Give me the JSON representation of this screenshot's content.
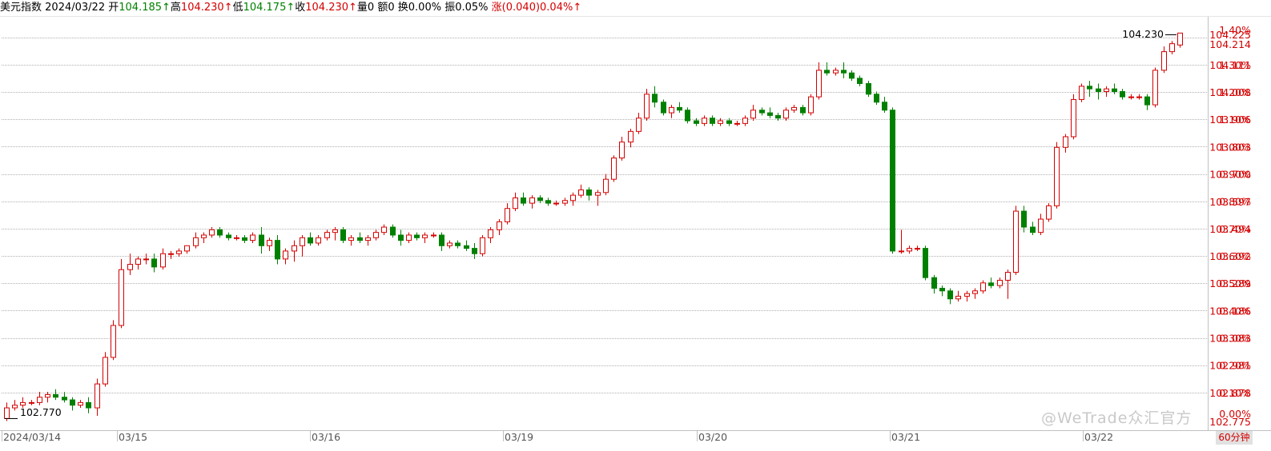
{
  "header": {
    "name": "美元指数",
    "date": "2024/03/22",
    "open_label": "开",
    "open_value": "104.185↑",
    "high_label": "高",
    "high_value": "104.230↑",
    "low_label": "低",
    "low_value": "104.175↑",
    "close_label": "收",
    "close_value": "104.230↑",
    "volume": "量0",
    "amount": "额0",
    "turnover": "换0.00%",
    "amplitude": "振0.05%",
    "change": "涨(0.040)0.04%↑"
  },
  "period_label": "60分钟",
  "watermark": "@WeTrade众汇官方",
  "colors": {
    "up": "#d40000",
    "down": "#008000",
    "grid": "#b0b0b0",
    "axis": "#c0c0c0"
  },
  "chart_data": {
    "type": "candlestick",
    "x_dates": [
      "2024/03/14",
      "03/15",
      "03/16",
      "03/19",
      "03/20",
      "03/21",
      "03/22"
    ],
    "ylim": [
      102.775,
      104.225
    ],
    "yaxis_price_ticks": [
      "104.225",
      "104.214",
      "104.111",
      "104.008",
      "103.906",
      "103.803",
      "103.700",
      "103.597",
      "103.494",
      "103.392",
      "103.289",
      "103.186",
      "103.083",
      "102.981",
      "102.878",
      "102.775"
    ],
    "yaxis_pct_ticks": [
      "1.40%",
      "1.30%",
      "1.20%",
      "1.10%",
      "1.00%",
      "0.90%",
      "0.80%",
      "0.70%",
      "0.60%",
      "0.50%",
      "0.40%",
      "0.30%",
      "0.20%",
      "0.10%",
      "0.00%"
    ],
    "high_marker": "104.230",
    "low_marker": "102.770",
    "candles": [
      [
        102.78,
        102.84,
        102.77,
        102.82
      ],
      [
        102.82,
        102.85,
        102.81,
        102.83
      ],
      [
        102.83,
        102.86,
        102.82,
        102.84
      ],
      [
        102.84,
        102.85,
        102.83,
        102.84
      ],
      [
        102.84,
        102.88,
        102.83,
        102.86
      ],
      [
        102.86,
        102.88,
        102.84,
        102.87
      ],
      [
        102.87,
        102.89,
        102.85,
        102.86
      ],
      [
        102.86,
        102.88,
        102.84,
        102.85
      ],
      [
        102.85,
        102.86,
        102.81,
        102.83
      ],
      [
        102.83,
        102.85,
        102.82,
        102.84
      ],
      [
        102.84,
        102.86,
        102.8,
        102.82
      ],
      [
        102.82,
        102.93,
        102.79,
        102.91
      ],
      [
        102.91,
        103.03,
        102.9,
        103.01
      ],
      [
        103.01,
        103.15,
        103.0,
        103.13
      ],
      [
        103.13,
        103.38,
        103.12,
        103.34
      ],
      [
        103.34,
        103.4,
        103.32,
        103.36
      ],
      [
        103.36,
        103.39,
        103.34,
        103.38
      ],
      [
        103.38,
        103.4,
        103.36,
        103.38
      ],
      [
        103.38,
        103.4,
        103.33,
        103.35
      ],
      [
        103.35,
        103.42,
        103.34,
        103.4
      ],
      [
        103.4,
        103.41,
        103.38,
        103.4
      ],
      [
        103.4,
        103.42,
        103.39,
        103.41
      ],
      [
        103.41,
        103.43,
        103.4,
        103.43
      ],
      [
        103.43,
        103.48,
        103.42,
        103.46
      ],
      [
        103.46,
        103.48,
        103.44,
        103.47
      ],
      [
        103.47,
        103.5,
        103.46,
        103.49
      ],
      [
        103.49,
        103.5,
        103.46,
        103.47
      ],
      [
        103.47,
        103.48,
        103.45,
        103.46
      ],
      [
        103.46,
        103.47,
        103.45,
        103.46
      ],
      [
        103.46,
        103.47,
        103.44,
        103.45
      ],
      [
        103.45,
        103.48,
        103.44,
        103.47
      ],
      [
        103.47,
        103.5,
        103.4,
        103.43
      ],
      [
        103.43,
        103.46,
        103.41,
        103.45
      ],
      [
        103.45,
        103.47,
        103.36,
        103.38
      ],
      [
        103.38,
        103.42,
        103.36,
        103.41
      ],
      [
        103.41,
        103.45,
        103.37,
        103.43
      ],
      [
        103.43,
        103.47,
        103.39,
        103.46
      ],
      [
        103.46,
        103.48,
        103.43,
        103.44
      ],
      [
        103.44,
        103.47,
        103.43,
        103.46
      ],
      [
        103.46,
        103.49,
        103.45,
        103.48
      ],
      [
        103.48,
        103.5,
        103.45,
        103.49
      ],
      [
        103.49,
        103.5,
        103.44,
        103.45
      ],
      [
        103.45,
        103.47,
        103.43,
        103.46
      ],
      [
        103.46,
        103.48,
        103.44,
        103.45
      ],
      [
        103.45,
        103.47,
        103.43,
        103.46
      ],
      [
        103.46,
        103.49,
        103.45,
        103.48
      ],
      [
        103.48,
        103.51,
        103.47,
        103.5
      ],
      [
        103.5,
        103.51,
        103.46,
        103.47
      ],
      [
        103.47,
        103.49,
        103.43,
        103.45
      ],
      [
        103.45,
        103.48,
        103.44,
        103.47
      ],
      [
        103.47,
        103.48,
        103.45,
        103.46
      ],
      [
        103.46,
        103.48,
        103.44,
        103.47
      ],
      [
        103.47,
        103.48,
        103.46,
        103.47
      ],
      [
        103.47,
        103.48,
        103.41,
        103.43
      ],
      [
        103.43,
        103.45,
        103.42,
        103.44
      ],
      [
        103.44,
        103.45,
        103.42,
        103.43
      ],
      [
        103.43,
        103.45,
        103.41,
        103.42
      ],
      [
        103.42,
        103.44,
        103.38,
        103.4
      ],
      [
        103.4,
        103.47,
        103.39,
        103.46
      ],
      [
        103.46,
        103.5,
        103.44,
        103.49
      ],
      [
        103.49,
        103.53,
        103.47,
        103.52
      ],
      [
        103.52,
        103.59,
        103.51,
        103.57
      ],
      [
        103.57,
        103.63,
        103.56,
        103.61
      ],
      [
        103.61,
        103.63,
        103.58,
        103.59
      ],
      [
        103.59,
        103.62,
        103.57,
        103.61
      ],
      [
        103.61,
        103.62,
        103.59,
        103.6
      ],
      [
        103.6,
        103.61,
        103.58,
        103.59
      ],
      [
        103.59,
        103.6,
        103.58,
        103.59
      ],
      [
        103.59,
        103.61,
        103.58,
        103.6
      ],
      [
        103.6,
        103.63,
        103.58,
        103.62
      ],
      [
        103.62,
        103.66,
        103.61,
        103.64
      ],
      [
        103.64,
        103.65,
        103.6,
        103.62
      ],
      [
        103.62,
        103.64,
        103.58,
        103.63
      ],
      [
        103.63,
        103.7,
        103.62,
        103.68
      ],
      [
        103.68,
        103.77,
        103.67,
        103.76
      ],
      [
        103.76,
        103.84,
        103.75,
        103.82
      ],
      [
        103.82,
        103.87,
        103.8,
        103.86
      ],
      [
        103.86,
        103.93,
        103.85,
        103.91
      ],
      [
        103.91,
        104.02,
        103.9,
        104.0
      ],
      [
        104.0,
        104.03,
        103.95,
        103.97
      ],
      [
        103.97,
        103.98,
        103.92,
        103.93
      ],
      [
        103.93,
        103.96,
        103.91,
        103.95
      ],
      [
        103.95,
        103.97,
        103.93,
        103.94
      ],
      [
        103.94,
        103.95,
        103.89,
        103.9
      ],
      [
        103.9,
        103.91,
        103.88,
        103.89
      ],
      [
        103.89,
        103.92,
        103.88,
        103.91
      ],
      [
        103.91,
        103.92,
        103.88,
        103.89
      ],
      [
        103.89,
        103.91,
        103.88,
        103.9
      ],
      [
        103.9,
        103.91,
        103.88,
        103.89
      ],
      [
        103.89,
        103.9,
        103.88,
        103.89
      ],
      [
        103.89,
        103.92,
        103.88,
        103.91
      ],
      [
        103.91,
        103.96,
        103.9,
        103.94
      ],
      [
        103.94,
        103.95,
        103.92,
        103.93
      ],
      [
        103.93,
        103.95,
        103.91,
        103.92
      ],
      [
        103.92,
        103.93,
        103.9,
        103.91
      ],
      [
        103.91,
        103.95,
        103.9,
        103.94
      ],
      [
        103.94,
        103.96,
        103.93,
        103.95
      ],
      [
        103.95,
        103.96,
        103.92,
        103.93
      ],
      [
        103.93,
        104.0,
        103.92,
        103.99
      ],
      [
        103.99,
        104.12,
        103.98,
        104.09
      ],
      [
        104.09,
        104.12,
        104.07,
        104.08
      ],
      [
        104.08,
        104.1,
        104.07,
        104.09
      ],
      [
        104.09,
        104.12,
        104.06,
        104.08
      ],
      [
        104.08,
        104.09,
        104.05,
        104.06
      ],
      [
        104.06,
        104.07,
        104.03,
        104.04
      ],
      [
        104.04,
        104.05,
        103.99,
        104.0
      ],
      [
        104.0,
        104.01,
        103.96,
        103.97
      ],
      [
        103.97,
        103.99,
        103.93,
        103.94
      ],
      [
        103.94,
        103.95,
        103.4,
        103.41
      ],
      [
        103.41,
        103.49,
        103.4,
        103.41
      ],
      [
        103.41,
        103.43,
        103.4,
        103.42
      ],
      [
        103.42,
        103.43,
        103.41,
        103.42
      ],
      [
        103.42,
        103.43,
        103.3,
        103.31
      ],
      [
        103.31,
        103.32,
        103.25,
        103.27
      ],
      [
        103.27,
        103.28,
        103.24,
        103.26
      ],
      [
        103.26,
        103.27,
        103.21,
        103.23
      ],
      [
        103.23,
        103.26,
        103.22,
        103.24
      ],
      [
        103.24,
        103.26,
        103.22,
        103.25
      ],
      [
        103.25,
        103.27,
        103.23,
        103.26
      ],
      [
        103.26,
        103.3,
        103.25,
        103.29
      ],
      [
        103.29,
        103.31,
        103.27,
        103.28
      ],
      [
        103.28,
        103.31,
        103.27,
        103.3
      ],
      [
        103.3,
        103.34,
        103.23,
        103.33
      ],
      [
        103.33,
        103.58,
        103.32,
        103.56
      ],
      [
        103.56,
        103.58,
        103.48,
        103.5
      ],
      [
        103.5,
        103.52,
        103.47,
        103.48
      ],
      [
        103.48,
        103.55,
        103.47,
        103.53
      ],
      [
        103.53,
        103.59,
        103.52,
        103.58
      ],
      [
        103.58,
        103.82,
        103.57,
        103.8
      ],
      [
        103.8,
        103.85,
        103.78,
        103.84
      ],
      [
        103.84,
        104.0,
        103.83,
        103.98
      ],
      [
        103.98,
        104.04,
        103.97,
        104.03
      ],
      [
        104.03,
        104.05,
        103.99,
        104.02
      ],
      [
        104.02,
        104.04,
        103.98,
        104.01
      ],
      [
        104.01,
        104.03,
        103.99,
        104.02
      ],
      [
        104.02,
        104.04,
        104.0,
        104.01
      ],
      [
        104.01,
        104.02,
        103.98,
        103.99
      ],
      [
        103.99,
        104.0,
        103.98,
        103.99
      ],
      [
        103.99,
        104.0,
        103.98,
        103.99
      ],
      [
        103.99,
        104.0,
        103.94,
        103.96
      ],
      [
        103.96,
        104.1,
        103.95,
        104.09
      ],
      [
        104.09,
        104.18,
        104.08,
        104.16
      ],
      [
        104.16,
        104.2,
        104.15,
        104.19
      ],
      [
        104.185,
        104.23,
        104.175,
        104.23
      ]
    ]
  }
}
